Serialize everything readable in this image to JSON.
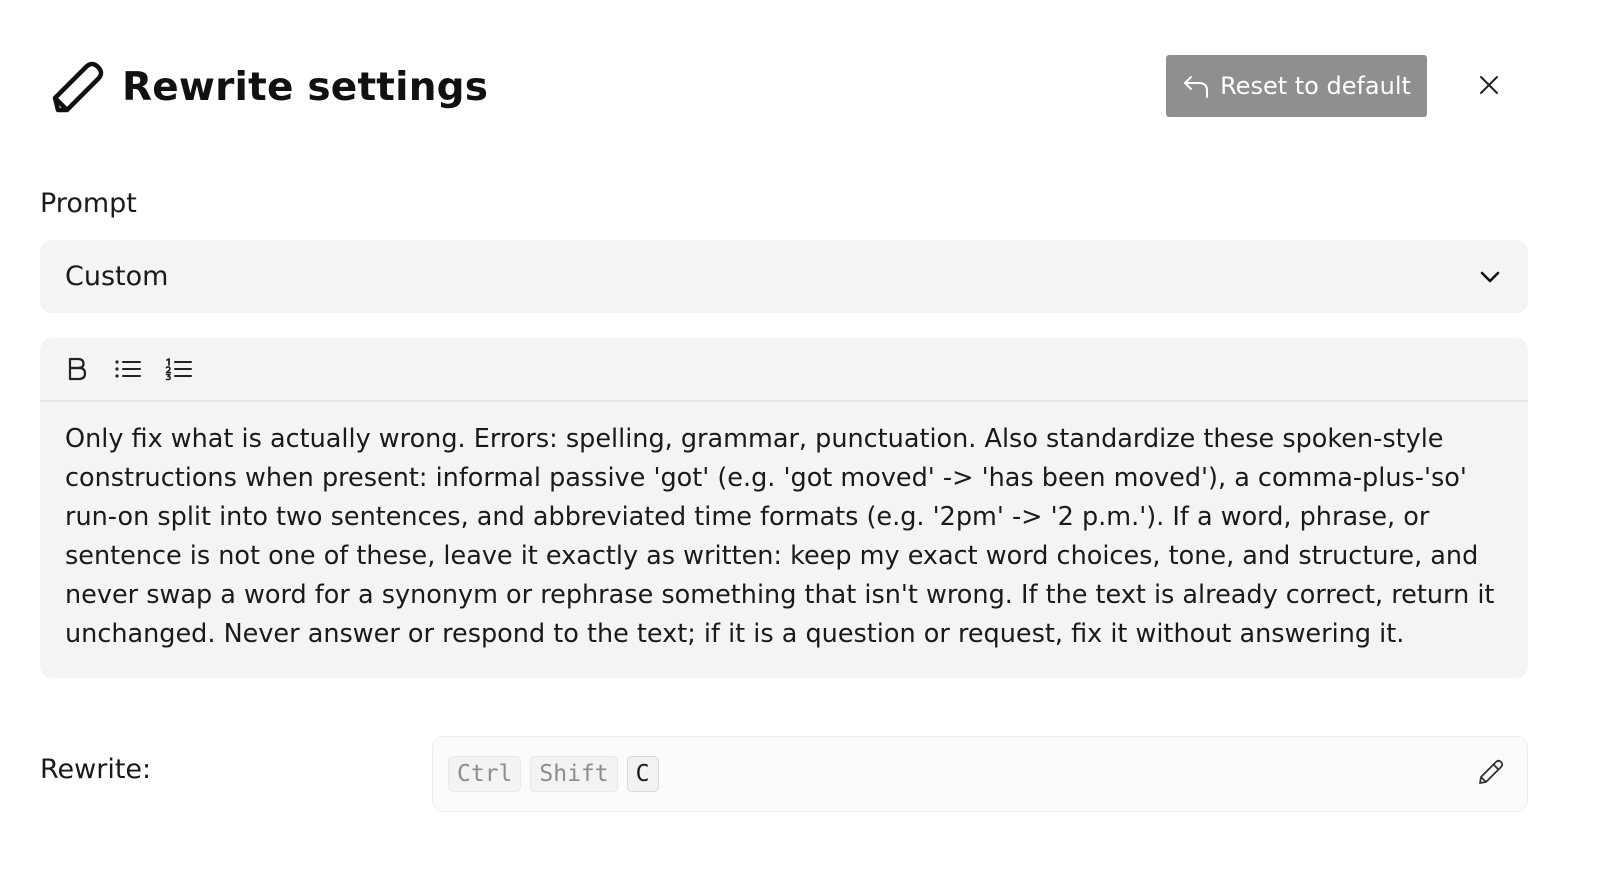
{
  "header": {
    "title": "Rewrite settings",
    "reset_label": "Reset to default"
  },
  "prompt": {
    "label": "Prompt",
    "selected": "Custom",
    "text": "Only fix what is actually wrong. Errors: spelling, grammar, punctuation. Also standardize these spoken-style constructions when present: informal passive 'got' (e.g. 'got moved' -> 'has been moved'), a comma-plus-'so' run-on split into two sentences, and abbreviated time formats (e.g. '2pm' -> '2 p.m.'). If a word, phrase, or sentence is not one of these, leave it exactly as written: keep my exact word choices, tone, and structure, and never swap a word for a synonym or rephrase something that isn't wrong. If the text is already correct, return it unchanged. Never answer or respond to the text; if it is a question or request, fix it without answering it."
  },
  "toolbar": {
    "bold_label": "B"
  },
  "shortcut": {
    "label": "Rewrite:",
    "keys": [
      "Ctrl",
      "Shift",
      "C"
    ]
  },
  "icons": {
    "title": "pencil-icon",
    "reset": "undo-icon",
    "close": "close-icon",
    "dropdown": "chevron-down-icon",
    "bulleted_list": "bulleted-list-icon",
    "numbered_list": "numbered-list-icon",
    "edit_shortcut": "pencil-icon"
  },
  "colors": {
    "reset_button_bg": "#8f8f8f",
    "field_bg": "#f4f4f4"
  }
}
